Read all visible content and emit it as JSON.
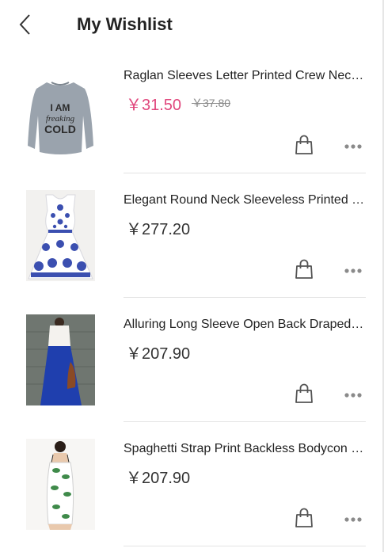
{
  "header": {
    "title": "My Wishlist",
    "back_icon": "chevron-left-icon"
  },
  "colors": {
    "sale_price": "#e0467c",
    "price": "#333333",
    "divider": "#e3e3e3",
    "icon": "#555555"
  },
  "items": [
    {
      "name": "Raglan Sleeves Letter Printed Crew Neck Sweatshirt",
      "price": "￥31.50",
      "old_price": "￥37.80",
      "image_text": [
        "I AM",
        "freaking",
        "COLD"
      ]
    },
    {
      "name": "Elegant Round Neck Sleeveless Printed Dress",
      "price": "￥277.20"
    },
    {
      "name": "Alluring Long Sleeve Open Back Draped Dress",
      "price": "￥207.90"
    },
    {
      "name": "Spaghetti Strap Print Backless Bodycon Dress",
      "price": "￥207.90"
    }
  ]
}
